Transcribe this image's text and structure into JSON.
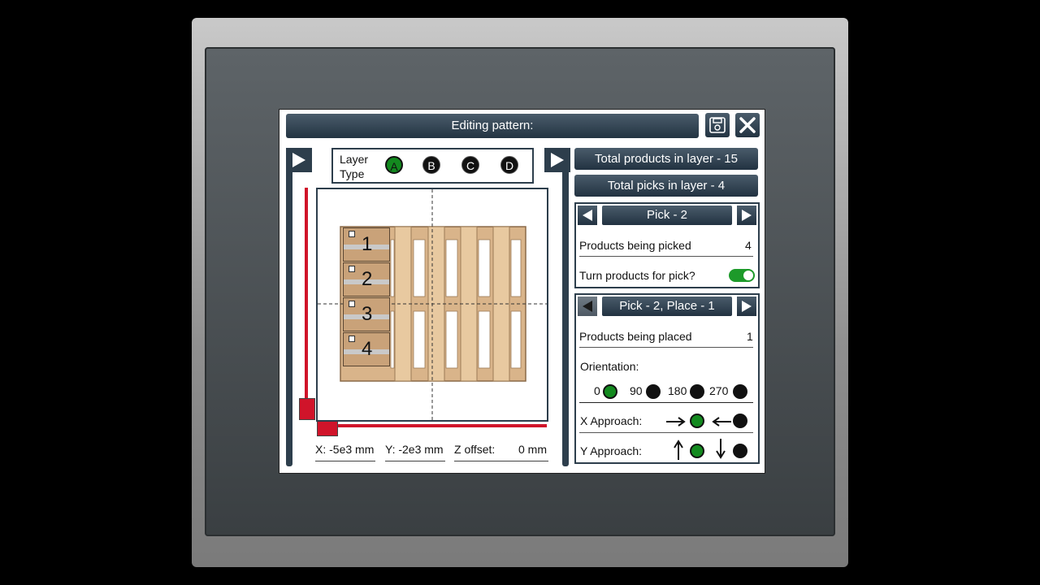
{
  "dialog": {
    "title": "Editing pattern:",
    "save_icon": "floppy-disk-icon",
    "close_icon": "close-icon"
  },
  "layer_type": {
    "label_line1": "Layer",
    "label_line2": "Type",
    "options": [
      "A",
      "B",
      "C",
      "D"
    ],
    "selected": "A"
  },
  "coords": {
    "x": "X: -5e3 mm",
    "y": "Y: -2e3 mm",
    "z_label": "Z offset:",
    "z_value": "0 mm"
  },
  "boxes": [
    "1",
    "2",
    "3",
    "4"
  ],
  "right_panel": {
    "total_products": "Total products in layer - 15",
    "total_picks": "Total picks in layer - 4",
    "pick_title": "Pick - 2",
    "products_picked_label": "Products being picked",
    "products_picked_value": "4",
    "turn_products_label": "Turn products for pick?",
    "turn_products_on": true,
    "place_title": "Pick - 2, Place - 1",
    "products_placed_label": "Products being placed",
    "products_placed_value": "1",
    "orientation_label": "Orientation:",
    "orientation_options": [
      "0",
      "90",
      "180",
      "270"
    ],
    "orientation_selected": "0",
    "x_approach_label": "X Approach:",
    "y_approach_label": "Y Approach:"
  },
  "colors": {
    "navy": "#2d3e4c",
    "selected_green": "#138a1f",
    "axis_red": "#d0142a",
    "pallet_wood": "#d9b48a"
  }
}
